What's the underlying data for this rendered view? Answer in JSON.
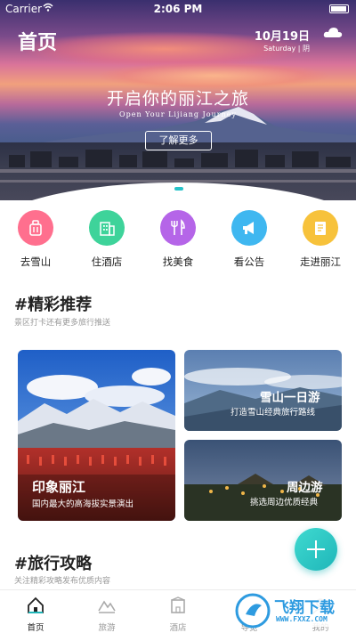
{
  "status": {
    "carrier": "Carrier",
    "time": "2:06 PM"
  },
  "header": {
    "title": "首页",
    "date": "10月19日",
    "weekday_weather": "Saturday | 阴"
  },
  "hero": {
    "title_cn": "开启你的丽江之旅",
    "title_en": "Open Your Lijiang Journey",
    "button": "了解更多"
  },
  "quick_nav": [
    {
      "label": "去雪山",
      "color": "#ff6f8e",
      "icon": "luggage-icon"
    },
    {
      "label": "住酒店",
      "color": "#3ed39a",
      "icon": "building-icon"
    },
    {
      "label": "找美食",
      "color": "#b565e8",
      "icon": "fork-knife-icon"
    },
    {
      "label": "看公告",
      "color": "#3fb7f0",
      "icon": "megaphone-icon"
    },
    {
      "label": "走进丽江",
      "color": "#f7c23b",
      "icon": "book-icon"
    }
  ],
  "recommend": {
    "title": "#精彩推荐",
    "subtitle": "景区打卡还有更多旅行推送",
    "cards": [
      {
        "title": "印象丽江",
        "subtitle": "国内最大的高海拔实景演出"
      },
      {
        "title": "雪山一日游",
        "subtitle": "打造雪山经典旅行路线"
      },
      {
        "title": "周边游",
        "subtitle": "挑选周边优质经典"
      }
    ]
  },
  "guide": {
    "title": "#旅行攻略",
    "subtitle": "关注精彩攻略发布优质内容"
  },
  "tabs": [
    {
      "label": "首页",
      "icon": "home-icon",
      "active": true
    },
    {
      "label": "旅游",
      "icon": "mountain-icon",
      "active": false
    },
    {
      "label": "酒店",
      "icon": "hotel-icon",
      "active": false
    },
    {
      "label": "导览",
      "icon": "guide-icon",
      "active": false
    },
    {
      "label": "我的",
      "icon": "user-icon",
      "active": false
    }
  ],
  "watermark": {
    "text": "飞翔下载",
    "url_text": "WWW.FXXZ.COM"
  },
  "colors": {
    "accent": "#1fb6b9",
    "text": "#222222",
    "muted": "#999999"
  }
}
